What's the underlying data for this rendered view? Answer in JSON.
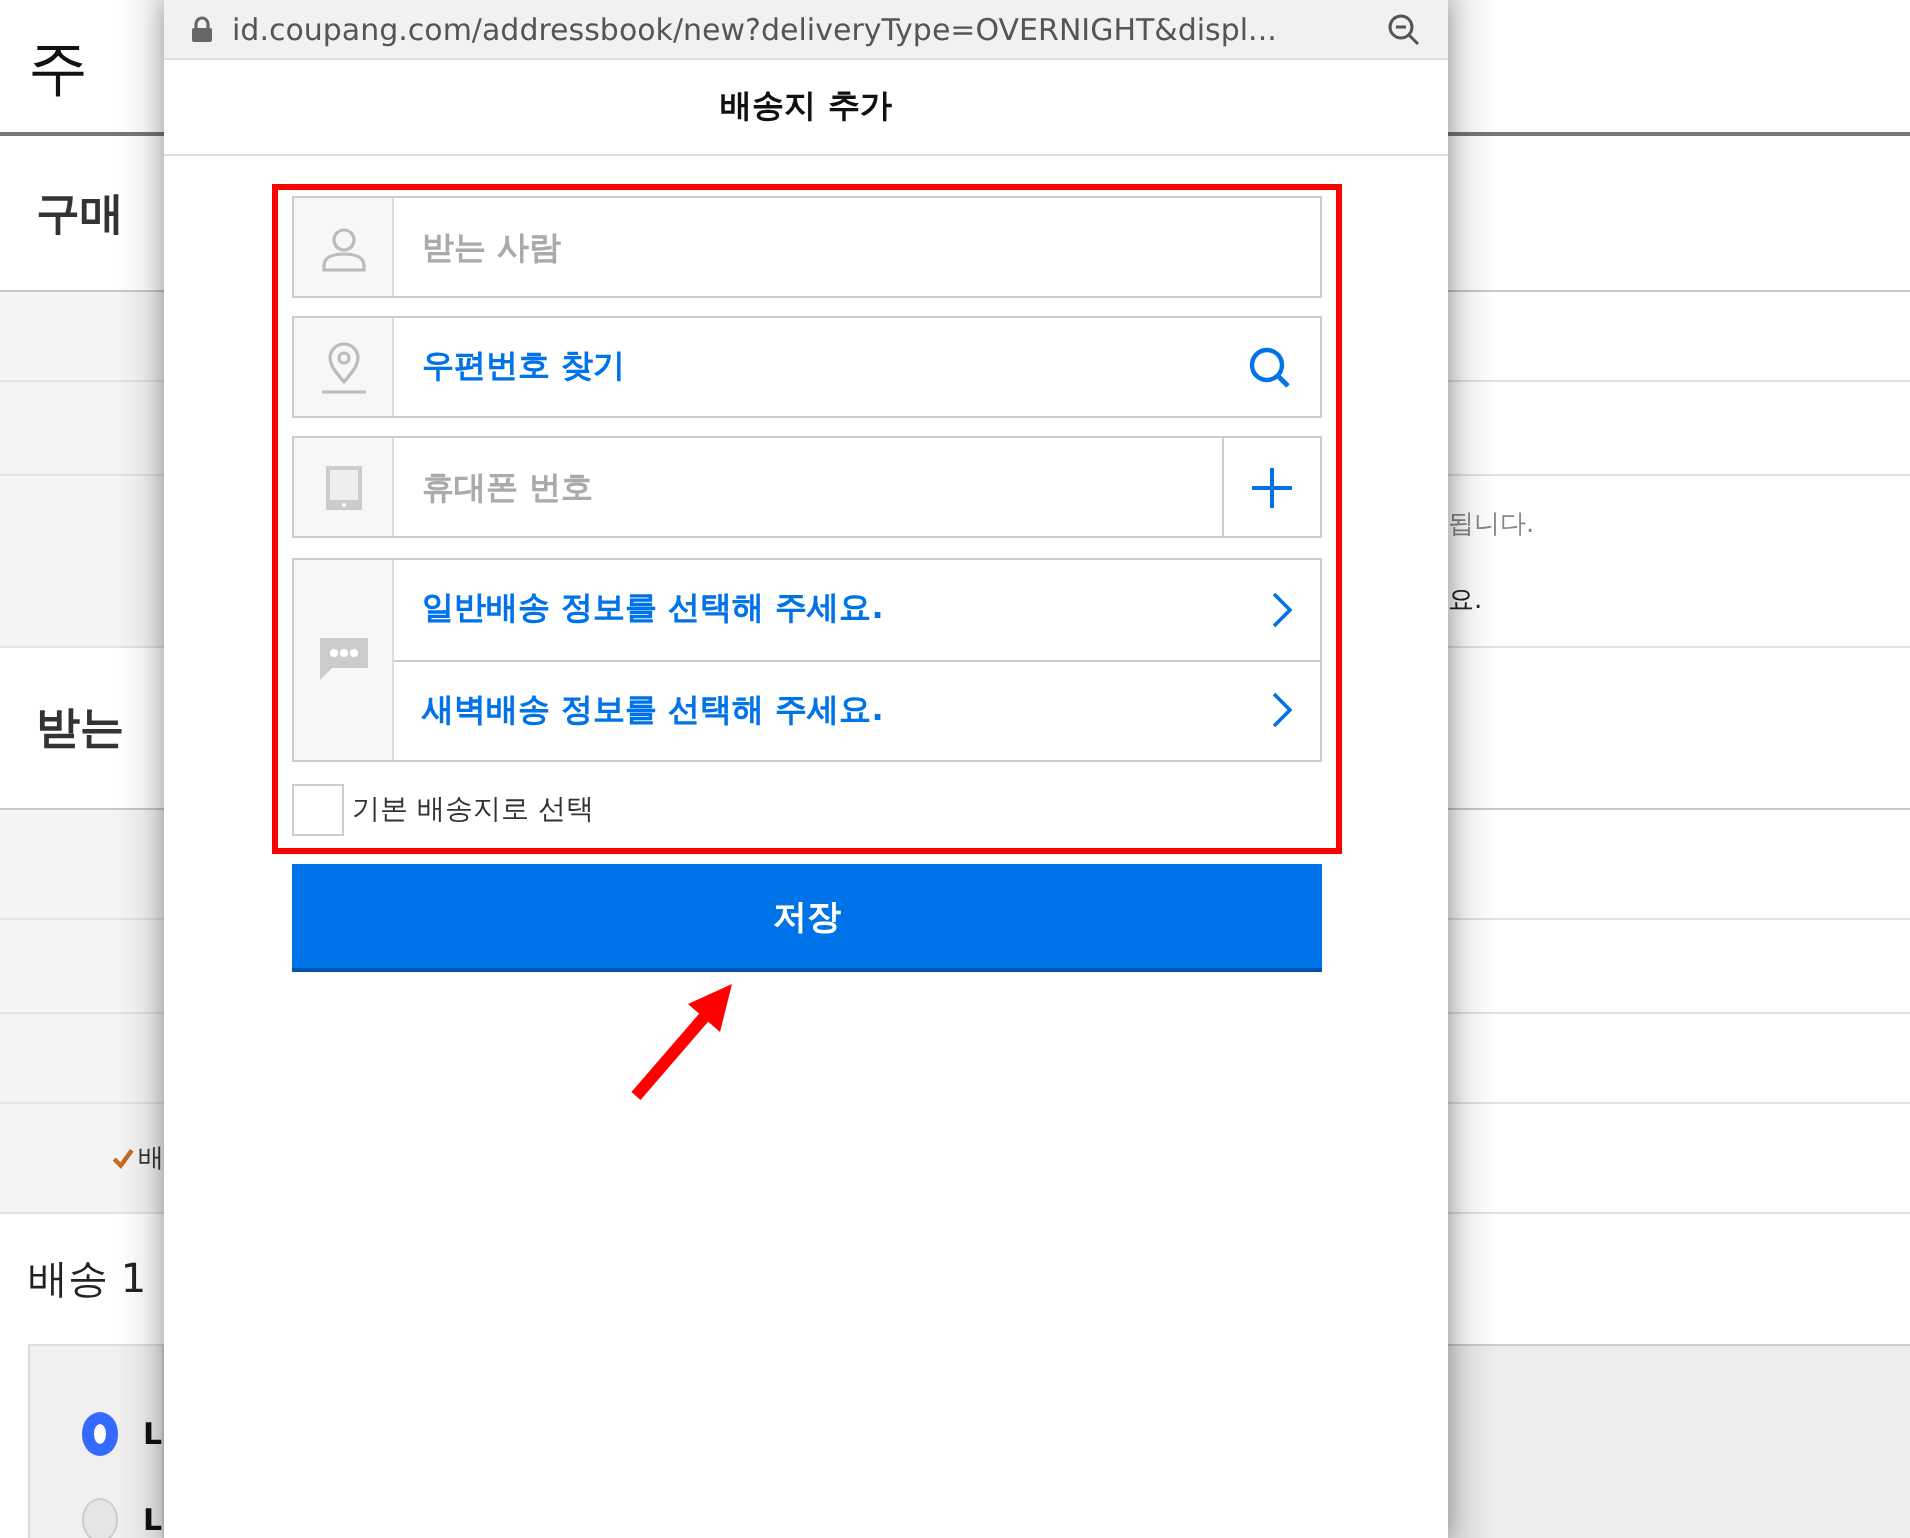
{
  "background": {
    "left": {
      "title": "주",
      "buyer_heading": "구매",
      "recipient_heading": "받는",
      "notice": "배",
      "shipping_heading": "배송 1",
      "options": [
        {
          "label": "L",
          "selected": true
        },
        {
          "label": "L",
          "selected": false
        }
      ]
    },
    "right": {
      "lines": [
        {
          "text": "됩니다.",
          "muted": true
        },
        {
          "text": "요.",
          "muted": false
        }
      ]
    }
  },
  "popup": {
    "url": "id.coupang.com/addressbook/new?deliveryType=OVERNIGHT&displ...",
    "title": "배송지 추가",
    "fields": [
      {
        "kind": "recipient",
        "placeholder": "받는 사람"
      },
      {
        "kind": "postcode",
        "label": "우편번호 찾기"
      },
      {
        "kind": "phone",
        "placeholder": "휴대폰 번호"
      },
      {
        "kind": "delivery",
        "options": [
          "일반배송 정보를 선택해 주세요.",
          "새벽배송 정보를 선택해 주세요."
        ]
      }
    ],
    "default_address": {
      "label": "기본 배송지로 선택",
      "checked": false
    },
    "save_button": "저장"
  }
}
